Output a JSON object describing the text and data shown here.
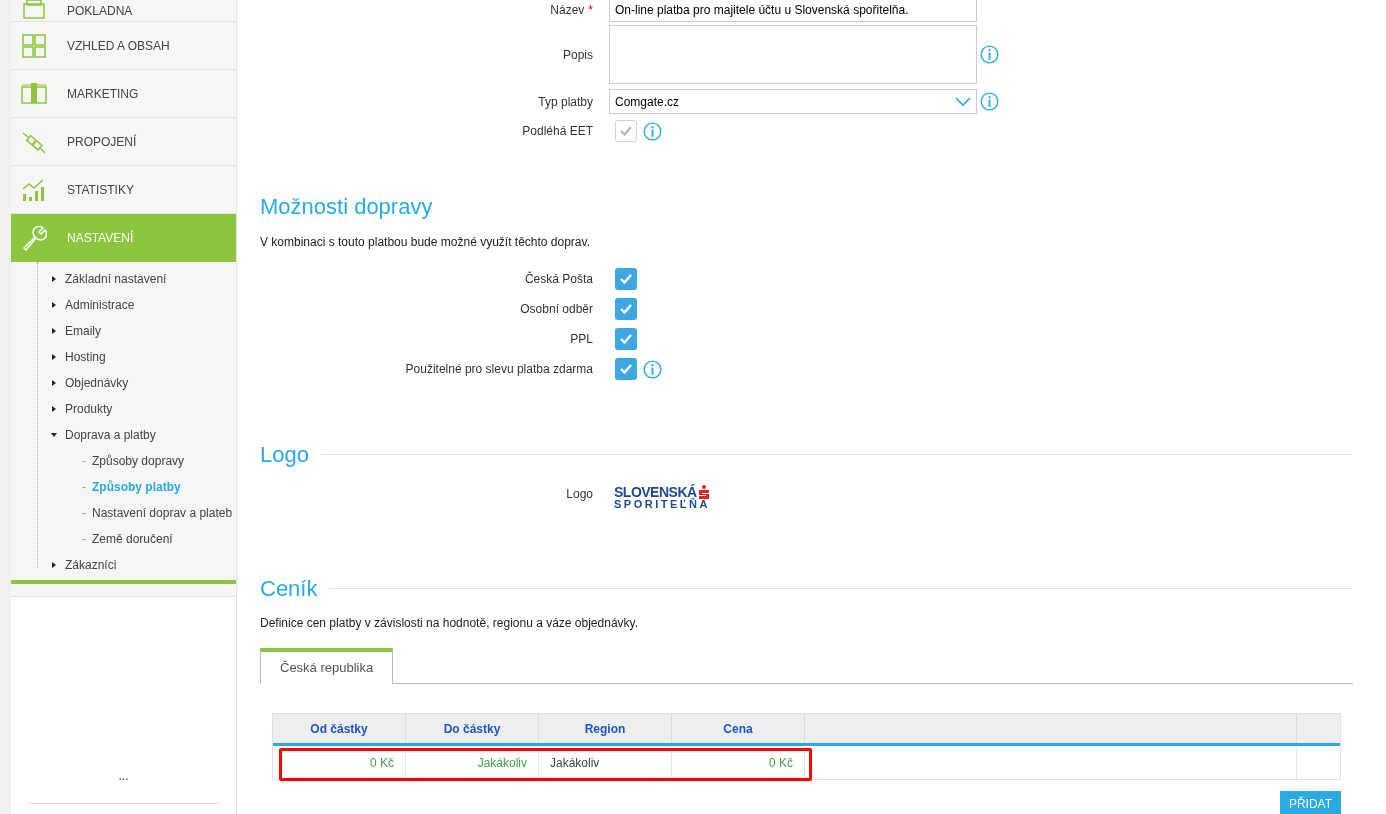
{
  "sidebar": {
    "nav": [
      {
        "label": "POKLADNA",
        "kind": "register",
        "selected": false
      },
      {
        "label": "VZHLED A OBSAH",
        "kind": "grid",
        "selected": false
      },
      {
        "label": "MARKETING",
        "kind": "money",
        "selected": false
      },
      {
        "label": "PROPOJENÍ",
        "kind": "plug",
        "selected": false
      },
      {
        "label": "STATISTIKY",
        "kind": "chart",
        "selected": false
      },
      {
        "label": "NASTAVENÍ",
        "kind": "wrench",
        "selected": true
      }
    ],
    "submenu": [
      {
        "label": "Základní nastavení",
        "expanded": false
      },
      {
        "label": "Administrace",
        "expanded": false
      },
      {
        "label": "Emaily",
        "expanded": false
      },
      {
        "label": "Hosting",
        "expanded": false
      },
      {
        "label": "Objednávky",
        "expanded": false
      },
      {
        "label": "Produkty",
        "expanded": false
      },
      {
        "label": "Doprava a platby",
        "expanded": true,
        "children": [
          {
            "marker": "-",
            "label": "Způsoby dopravy",
            "selected": false
          },
          {
            "marker": "-",
            "label": "Způsoby platby",
            "selected": true
          },
          {
            "marker": "-",
            "label": "Nastavení doprav a plateb",
            "selected": false
          },
          {
            "marker": "-",
            "label": "Země doručení",
            "selected": false
          }
        ]
      },
      {
        "label": "Zákazníci",
        "expanded": false
      }
    ],
    "footer": "..."
  },
  "form": {
    "name": {
      "label": "Název",
      "required_mark": "*",
      "value": "On-line platba pro majitele účtu u Slovenská spořitelňa."
    },
    "description": {
      "label": "Popis"
    },
    "payment_type": {
      "label": "Typ platby",
      "value": "Comgate.cz"
    },
    "eet": {
      "label": "Podléhá EET",
      "checked": true,
      "disabled": true
    }
  },
  "shipping": {
    "title": "Možnosti dopravy",
    "description": "V kombinaci s touto platbou bude možné využít těchto doprav.",
    "options": [
      {
        "label": "Česká Pošta",
        "checked": true,
        "info": false
      },
      {
        "label": "Osobní odběr",
        "checked": true,
        "info": false
      },
      {
        "label": "PPL",
        "checked": true,
        "info": false
      },
      {
        "label": "Použitelné pro slevu platba zdarma",
        "checked": true,
        "info": true
      }
    ]
  },
  "logo": {
    "title": "Logo",
    "label": "Logo",
    "logo_line_1": "SLOVENSKÁ",
    "logo_line_2": "SPORITEĽŇA"
  },
  "pricing": {
    "title": "Ceník",
    "description": "Definice cen platby v závislosti na hodnotě, regionu a váze objednávky.",
    "tabs": [
      {
        "label": "Česká republika",
        "selected": true
      }
    ],
    "table": {
      "columns": [
        "Od částky",
        "Do částky",
        "Region",
        "Cena"
      ],
      "rows": [
        {
          "highlighted": true,
          "cells": [
            {
              "text": "0 Kč",
              "color": "#43a047"
            },
            {
              "text": "Jakákoliv",
              "color": "#43a047"
            },
            {
              "text": "Jakákoliv",
              "color": "#444444"
            },
            {
              "text": "0 Kč",
              "color": "#43a047"
            }
          ]
        }
      ]
    },
    "add_button": "PŘIDAT"
  }
}
